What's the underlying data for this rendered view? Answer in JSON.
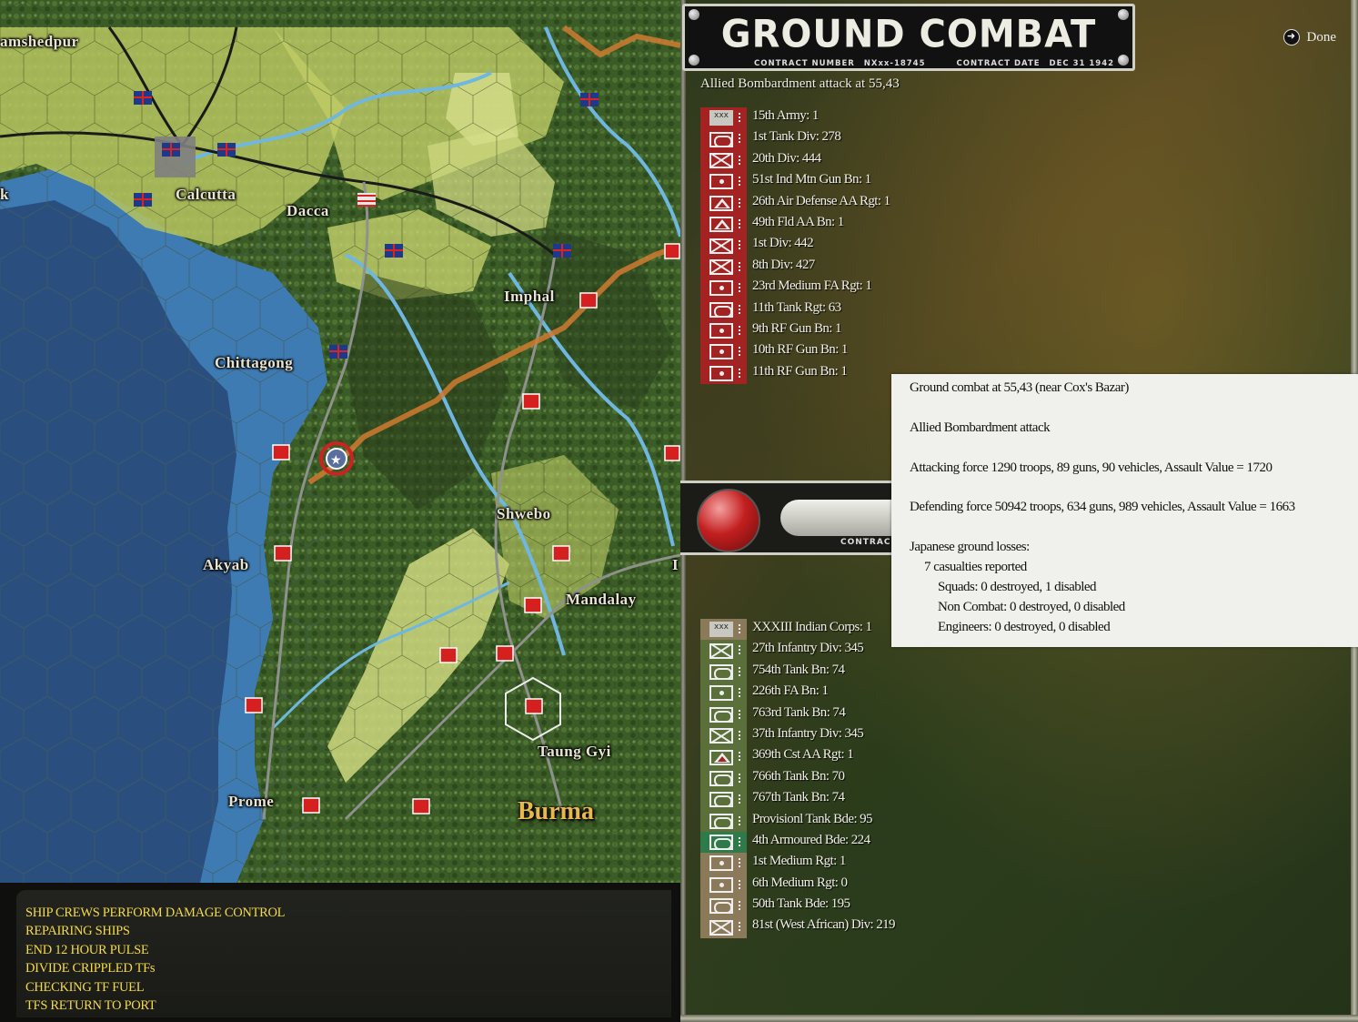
{
  "map": {
    "cities": [
      "amshedpur",
      "Calcutta",
      "Dacca",
      "Imphal",
      "Chittagong",
      "Shwebo",
      "Akyab",
      "Mandalay",
      "Taung Gyi",
      "Prome"
    ],
    "region": "Burma",
    "edge_letter_left": "k",
    "edge_letter_right": "I",
    "colors": {
      "sea_deep": "#2a4f7e",
      "sea_shallow": "#3f7bb3",
      "jungle": "#3a5a26",
      "plains": "#c8d46a",
      "roads": "#888a85"
    }
  },
  "log": {
    "lines": [
      "SHIP CREWS PERFORM DAMAGE CONTROL",
      "REPAIRING SHIPS",
      "END 12 HOUR PULSE",
      "DIVIDE CRIPPLED TFs",
      "CHECKING TF FUEL",
      "TFS RETURN TO PORT"
    ]
  },
  "panel": {
    "title": "GROUND COMBAT",
    "contract_number_label": "CONTRACT NUMBER",
    "contract_number": "NXxx-18745",
    "contract_date_label": "CONTRACT DATE",
    "contract_date": "DEC 31 1942",
    "done_label": "Done",
    "attack_title": "Allied Bombardment attack at 55,43",
    "mid_label": "CONTRAC",
    "attackers": [
      {
        "label": "15th Army: 1",
        "type": "hq"
      },
      {
        "label": "1st Tank Div: 278",
        "type": "arm"
      },
      {
        "label": "20th Div: 444",
        "type": "inf"
      },
      {
        "label": "51st Ind Mtn Gun Bn: 1",
        "type": "art"
      },
      {
        "label": "26th Air Defense AA Rgt: 1",
        "type": "aa"
      },
      {
        "label": "49th Fld AA Bn: 1",
        "type": "aa"
      },
      {
        "label": "1st Div: 442",
        "type": "inf"
      },
      {
        "label": "8th Div: 427",
        "type": "inf"
      },
      {
        "label": "23rd Medium FA Rgt: 1",
        "type": "art"
      },
      {
        "label": "11th Tank Rgt: 63",
        "type": "arm"
      },
      {
        "label": "9th RF Gun Bn: 1",
        "type": "art"
      },
      {
        "label": "10th RF Gun Bn: 1",
        "type": "art"
      },
      {
        "label": "11th RF Gun Bn: 1",
        "type": "art"
      }
    ],
    "defenders": [
      {
        "label": "XXXIII Indian Corps: 1",
        "type": "hq",
        "color": "tan"
      },
      {
        "label": "27th Infantry Div: 345",
        "type": "inf",
        "color": "green"
      },
      {
        "label": "754th Tank Bn: 74",
        "type": "arm",
        "color": "green"
      },
      {
        "label": "226th FA Bn: 1",
        "type": "art",
        "color": "green"
      },
      {
        "label": "763rd Tank Bn: 74",
        "type": "arm",
        "color": "green"
      },
      {
        "label": "37th Infantry Div: 345",
        "type": "inf",
        "color": "green"
      },
      {
        "label": "369th Cst AA Rgt: 1",
        "type": "aa",
        "color": "green"
      },
      {
        "label": "766th Tank Bn: 70",
        "type": "arm",
        "color": "green"
      },
      {
        "label": "767th Tank Bn: 74",
        "type": "arm",
        "color": "green"
      },
      {
        "label": "Provisionl Tank Bde: 95",
        "type": "arm",
        "color": "green"
      },
      {
        "label": "4th Armoured Bde: 224",
        "type": "arm",
        "color": "green2"
      },
      {
        "label": "1st Medium Rgt: 1",
        "type": "art",
        "color": "tan"
      },
      {
        "label": "6th Medium Rgt: 0",
        "type": "art",
        "color": "tan"
      },
      {
        "label": "50th Tank Bde: 195",
        "type": "arm",
        "color": "tan"
      },
      {
        "label": "81st (West African) Div: 219",
        "type": "inf",
        "color": "tan"
      }
    ]
  },
  "report": {
    "location": "Ground combat at 55,43 (near Cox's Bazar)",
    "attack_type": "Allied Bombardment attack",
    "attacking_force": "Attacking force 1290 troops, 89 guns, 90 vehicles, Assault Value = 1720",
    "defending_force": "Defending force 50942 troops, 634 guns, 989 vehicles, Assault Value = 1663",
    "losses_header": "Japanese ground losses:",
    "casualties": "7 casualties reported",
    "squads": "Squads: 0 destroyed, 1 disabled",
    "non_combat": "Non Combat: 0 destroyed, 0 disabled",
    "engineers": "Engineers: 0 destroyed, 0 disabled"
  }
}
